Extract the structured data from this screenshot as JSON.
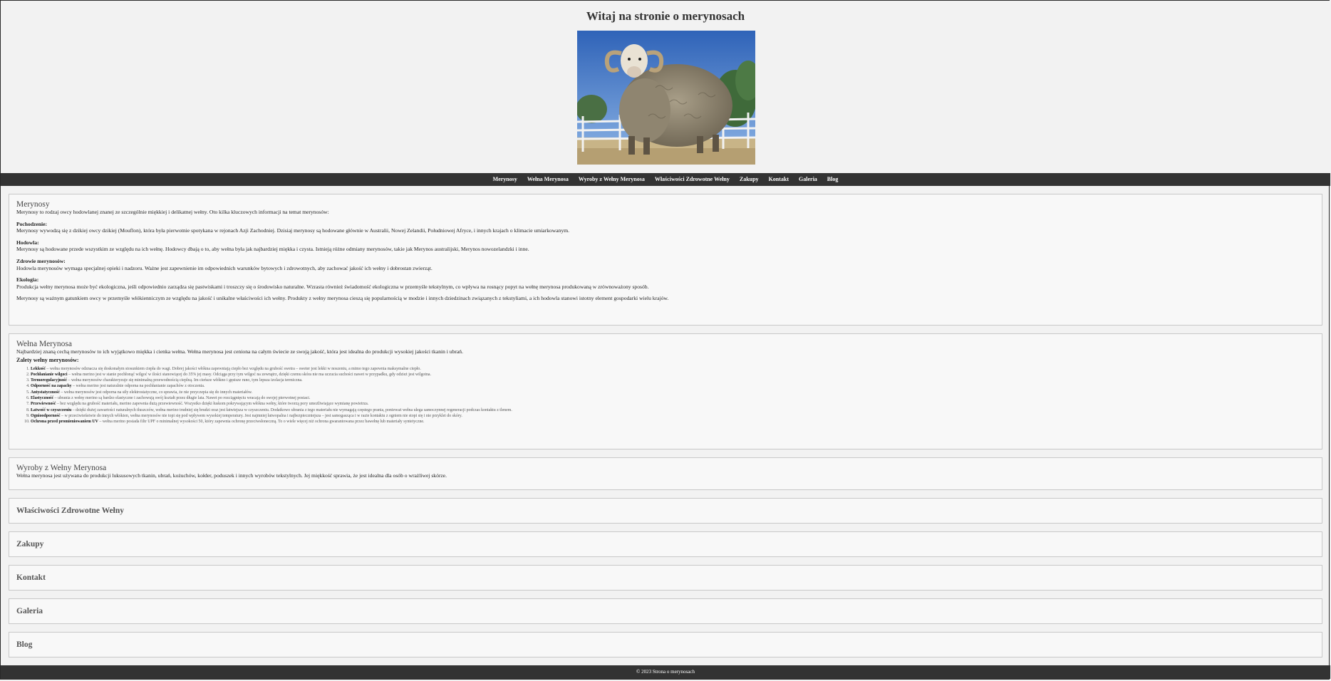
{
  "header": {
    "title": "Witaj na stronie o merynosach"
  },
  "nav": [
    "Merynosy",
    "Wełna Merynosa",
    "Wyroby z Wełny Merynosa",
    "Właściwości Zdrowotne Wełny",
    "Zakupy",
    "Kontakt",
    "Galeria",
    "Blog"
  ],
  "merynosy": {
    "title": "Merynosy",
    "intro": "Merynosy to rodzaj owcy hodowlanej znanej ze szczególnie miękkiej i delikatnej wełny. Oto kilka kluczowych informacji na temat merynosów:",
    "pochodzenie_label": "Pochodzenie:",
    "pochodzenie_text": "Merynosy wywodzą się z dzikiej owcy dzikiej (Mouflon), która była pierwotnie spotykana w rejonach Azji Zachodniej. Dzisiaj merynosy są hodowane głównie w Australii, Nowej Zelandii, Południowej Afryce, i innych krajach o klimacie umiarkowanym.",
    "hodowla_label": "Hodowla:",
    "hodowla_text": "Merynosy są hodowane przede wszystkim ze względu na ich wełnę. Hodowcy dbają o to, aby wełna była jak najbardziej miękka i czysta. Istnieją różne odmiany merynosów, takie jak Merynos australijski, Merynos nowozelandzki i inne.",
    "zdrowie_label": "Zdrowie merynosów:",
    "zdrowie_text": "Hodowla merynosów wymaga specjalnej opieki i nadzoru. Ważne jest zapewnienie im odpowiednich warunków bytowych i zdrowotnych, aby zachować jakość ich wełny i dobrostan zwierząt.",
    "ekologia_label": "Ekologia:",
    "ekologia_text": "Produkcja wełny merynosa może być ekologiczna, jeśli odpowiednio zarządza się pastwiskami i troszczy się o środowisko naturalne. Wzrasta również świadomość ekologiczna w przemyśle tekstylnym, co wpływa na rosnący popyt na wełnę merynosa produkowaną w zrównoważony sposób.",
    "summary": "Merynosy są ważnym gatunkiem owcy w przemyśle włókienniczym ze względu na jakość i unikalne właściwości ich wełny. Produkty z wełny merynosa cieszą się popularnością w modzie i innych dziedzinach związanych z tekstyliami, a ich hodowla stanowi istotny element gospodarki wielu krajów."
  },
  "welna": {
    "title": "Wełna Merynosa",
    "intro": "Najbardziej znaną cechą merynosów to ich wyjątkowo miękka i cienka wełna. Wełna merynosa jest ceniona na całym świecie ze swoją jakość, która jest idealna do produkcji wysokiej jakości tkanin i ubrań.",
    "zalety_label": "Zalety wełny merynosów:",
    "zalety": [
      {
        "name": "Lekkość",
        "text": " – wełna merynosów odznacza się doskonałym stosunkiem ciepła do wagi. Dobrej jakości włókna zapewniają ciepło bez względu na grubość swetra – sweter jest lekki w noszeniu, a mimo tego zapewnia maksymalne ciepło."
      },
      {
        "name": "Pochłanianie wilgoci",
        "text": " – wełna merino jest w stanie pochłonąć wilgoć w ilości stanowiącej do 35% jej masy. Odciąga przy tym wilgoć na zewnątrz, dzięki czemu skóra nie ma uczucia suchości nawet w przypadku, gdy odzież jest wilgotna."
      },
      {
        "name": "Termoregulacyjność",
        "text": " – wełna merynosów charakteryzuje się minimalną przewodnością cieplną. Im cieńsze włókno i gęstsze runo, tym lepsza izolacja termiczna."
      },
      {
        "name": "Odporność na zapachy",
        "text": " – wełna merino jest naturalnie odporna na pochłanianie zapachów z otoczenia."
      },
      {
        "name": "Antystatyczność",
        "text": " – wełna merynosów jest odporna na siły elektrostatyczne, co sprawia, że nie przyczepia się do innych materiałów."
      },
      {
        "name": "Elastyczność",
        "text": " – ubrania z wełny merino są bardzo elastyczne i zachowują swój kształt przez długie lata. Nawet po rozciągnięciu wracają do swojej pierwotnej postaci."
      },
      {
        "name": "Przewiewność",
        "text": " – bez względu na grubość materiału, merino zapewnia dużą przewiewność. Wszystko dzięki łuskom pokrywającym włókna wełny, które tworzą pory umożliwiające wymianę powietrza."
      },
      {
        "name": "Łatwość w czyszczeniu",
        "text": " – dzięki dużej zawartości naturalnych tłuszczów, wełna merino trudniej się brudzi oraz jest łatwiejsza w czyszczeniu. Dodatkowo ubrania z tego materiału nie wymagają częstego prania, ponieważ wełna ulega samoczynnej regeneracji podczas kontaktu z tlenem."
      },
      {
        "name": "Ognioodporność",
        "text": " – w przeciwieństwie do innych włókien, wełna merynosów nie topi się pod wpływem wysokiej temperatury. Jest najmniej łatwopalna i najbezpieczniejsza – jest samogasząca i w razie kontaktu z ogniem nie stopi się i nie przyklei do skóry."
      },
      {
        "name": "Ochrona przed promieniowaniem UV",
        "text": " – wełna merino posiada filtr UPF o minimalnej wysokości 50, który zapewnia ochronę przeciwsłoneczną. To o wiele więcej niż ochrona gwarantowana przez bawełnę lub materiały syntetyczne."
      }
    ]
  },
  "wyroby": {
    "title": "Wyroby z Wełny Merynosa",
    "text": "Wełna merynosa jest używana do produkcji luksusowych tkanin, ubrań, kożuchów, kołder, poduszek i innych wyrobów tekstylnych. Jej miękkość sprawia, że jest idealna dla osób o wrażliwej skórze."
  },
  "wlasciwosci": {
    "title": "Właściwości Zdrowotne Wełny"
  },
  "zakupy": {
    "title": "Zakupy"
  },
  "kontakt": {
    "title": "Kontakt"
  },
  "galeria": {
    "title": "Galeria"
  },
  "blog": {
    "title": "Blog"
  },
  "footer": {
    "text": "© 2023 Strona o merynosach"
  }
}
